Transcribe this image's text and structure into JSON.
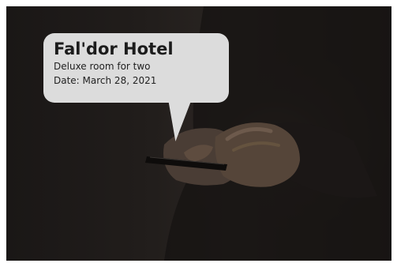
{
  "bubble": {
    "title": "Fal'dor Hotel",
    "line1": "Deluxe room for two",
    "line2": "Date: March  28, 2021"
  },
  "colors": {
    "bubble_fill": "#dcdcdc",
    "background_dark": "#1f1b19"
  },
  "photo": {
    "subject": "person-holding-smartphone-icon"
  }
}
